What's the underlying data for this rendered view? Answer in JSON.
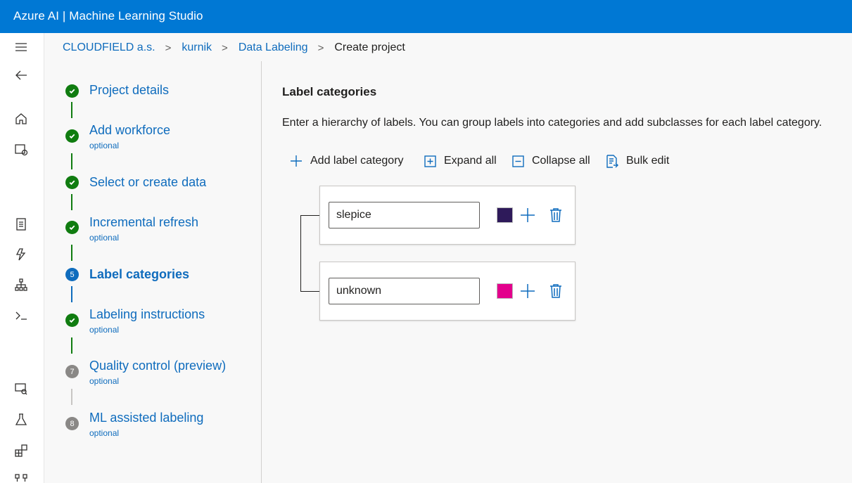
{
  "app": {
    "title": "Azure AI | Machine Learning Studio"
  },
  "leftnav": {
    "icons": [
      "hamburger-icon",
      "back-arrow-icon",
      "home-icon",
      "model-catalog-icon",
      "notebook-icon",
      "automl-icon",
      "designer-icon",
      "terminal-icon",
      "monitor-icon",
      "experiment-icon",
      "components-icon",
      "pipelines-icon"
    ]
  },
  "breadcrumb": {
    "items": [
      "CLOUDFIELD a.s.",
      "kurnik",
      "Data Labeling"
    ],
    "current": "Create project"
  },
  "steps": [
    {
      "label": "Project details",
      "status": "done"
    },
    {
      "label": "Add workforce",
      "sub": "optional",
      "status": "done"
    },
    {
      "label": "Select or create data",
      "status": "done"
    },
    {
      "label": "Incremental refresh",
      "sub": "optional",
      "status": "done"
    },
    {
      "label": "Label categories",
      "status": "active",
      "number": "5"
    },
    {
      "label": "Labeling instructions",
      "sub": "optional",
      "status": "done"
    },
    {
      "label": "Quality control (preview)",
      "sub": "optional",
      "status": "todo",
      "number": "7"
    },
    {
      "label": "ML assisted labeling",
      "sub": "optional",
      "status": "todo",
      "number": "8"
    }
  ],
  "content": {
    "title": "Label categories",
    "description": "Enter a hierarchy of labels. You can group labels into categories and add subclasses for each label category.",
    "toolbar": {
      "add": "Add label category",
      "expand": "Expand all",
      "collapse": "Collapse all",
      "bulk": "Bulk edit"
    },
    "labels": [
      {
        "name": "slepice",
        "color": "#2e1a5a"
      },
      {
        "name": "unknown",
        "color": "#e3008c"
      }
    ]
  },
  "colors": {
    "brand": "#0078d4",
    "link": "#0f6cbd",
    "done": "#107c10",
    "todo": "#8a8886"
  }
}
